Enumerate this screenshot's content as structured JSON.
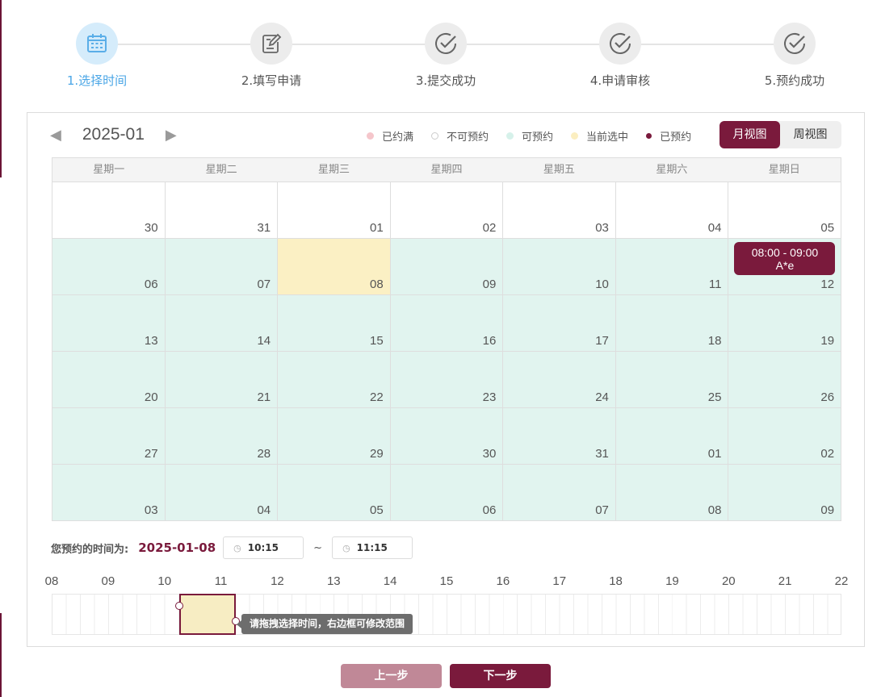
{
  "steps": [
    {
      "label": "1.选择时间",
      "icon": "calendar-icon",
      "active": true
    },
    {
      "label": "2.填写申请",
      "icon": "edit-icon",
      "active": false
    },
    {
      "label": "3.提交成功",
      "icon": "check-circle-icon",
      "active": false
    },
    {
      "label": "4.申请审核",
      "icon": "check-circle-icon",
      "active": false
    },
    {
      "label": "5.预约成功",
      "icon": "check-circle-icon",
      "active": false
    }
  ],
  "calendar": {
    "month": "2025-01",
    "prev_arrow": "◀",
    "next_arrow": "▶",
    "legend": [
      {
        "label": "已约满",
        "color": "#f5c6cb"
      },
      {
        "label": "不可预约",
        "color": "#ffffff"
      },
      {
        "label": "可预约",
        "color": "#d6f1ea"
      },
      {
        "label": "当前选中",
        "color": "#fbeec0"
      },
      {
        "label": "已预约",
        "color": "#7a1a3c"
      }
    ],
    "views": {
      "month": "月视图",
      "week": "周视图"
    },
    "weekdays": [
      "星期一",
      "星期二",
      "星期三",
      "星期四",
      "星期五",
      "星期六",
      "星期日"
    ],
    "weeks": [
      [
        {
          "d": "30",
          "s": "none"
        },
        {
          "d": "31",
          "s": "none"
        },
        {
          "d": "01",
          "s": "none"
        },
        {
          "d": "02",
          "s": "none"
        },
        {
          "d": "03",
          "s": "none"
        },
        {
          "d": "04",
          "s": "none"
        },
        {
          "d": "05",
          "s": "none"
        }
      ],
      [
        {
          "d": "06",
          "s": "avail"
        },
        {
          "d": "07",
          "s": "avail"
        },
        {
          "d": "08",
          "s": "sel"
        },
        {
          "d": "09",
          "s": "avail"
        },
        {
          "d": "10",
          "s": "avail"
        },
        {
          "d": "11",
          "s": "avail"
        },
        {
          "d": "12",
          "s": "avail",
          "event": {
            "time": "08:00 - 09:00",
            "title": "A*e"
          }
        }
      ],
      [
        {
          "d": "13",
          "s": "avail"
        },
        {
          "d": "14",
          "s": "avail"
        },
        {
          "d": "15",
          "s": "avail"
        },
        {
          "d": "16",
          "s": "avail"
        },
        {
          "d": "17",
          "s": "avail"
        },
        {
          "d": "18",
          "s": "avail"
        },
        {
          "d": "19",
          "s": "avail"
        }
      ],
      [
        {
          "d": "20",
          "s": "avail"
        },
        {
          "d": "21",
          "s": "avail"
        },
        {
          "d": "22",
          "s": "avail"
        },
        {
          "d": "23",
          "s": "avail"
        },
        {
          "d": "24",
          "s": "avail"
        },
        {
          "d": "25",
          "s": "avail"
        },
        {
          "d": "26",
          "s": "avail"
        }
      ],
      [
        {
          "d": "27",
          "s": "avail"
        },
        {
          "d": "28",
          "s": "avail"
        },
        {
          "d": "29",
          "s": "avail"
        },
        {
          "d": "30",
          "s": "avail"
        },
        {
          "d": "31",
          "s": "avail"
        },
        {
          "d": "01",
          "s": "avail"
        },
        {
          "d": "02",
          "s": "avail"
        }
      ],
      [
        {
          "d": "03",
          "s": "avail"
        },
        {
          "d": "04",
          "s": "avail"
        },
        {
          "d": "05",
          "s": "avail"
        },
        {
          "d": "06",
          "s": "avail"
        },
        {
          "d": "07",
          "s": "avail"
        },
        {
          "d": "08",
          "s": "avail"
        },
        {
          "d": "09",
          "s": "avail"
        }
      ]
    ]
  },
  "booking": {
    "label": "您预约的时间为:",
    "date": "2025-01-08",
    "start": "10:15",
    "end": "11:15",
    "separator": "~"
  },
  "timeline": {
    "hours": [
      "08",
      "09",
      "10",
      "11",
      "12",
      "13",
      "14",
      "15",
      "16",
      "17",
      "18",
      "19",
      "20",
      "21",
      "22"
    ],
    "range_start_hour": 10.25,
    "range_end_hour": 11.25,
    "tooltip": "请拖拽选择时间，右边框可修改范围"
  },
  "buttons": {
    "prev": "上一步",
    "next": "下一步"
  }
}
